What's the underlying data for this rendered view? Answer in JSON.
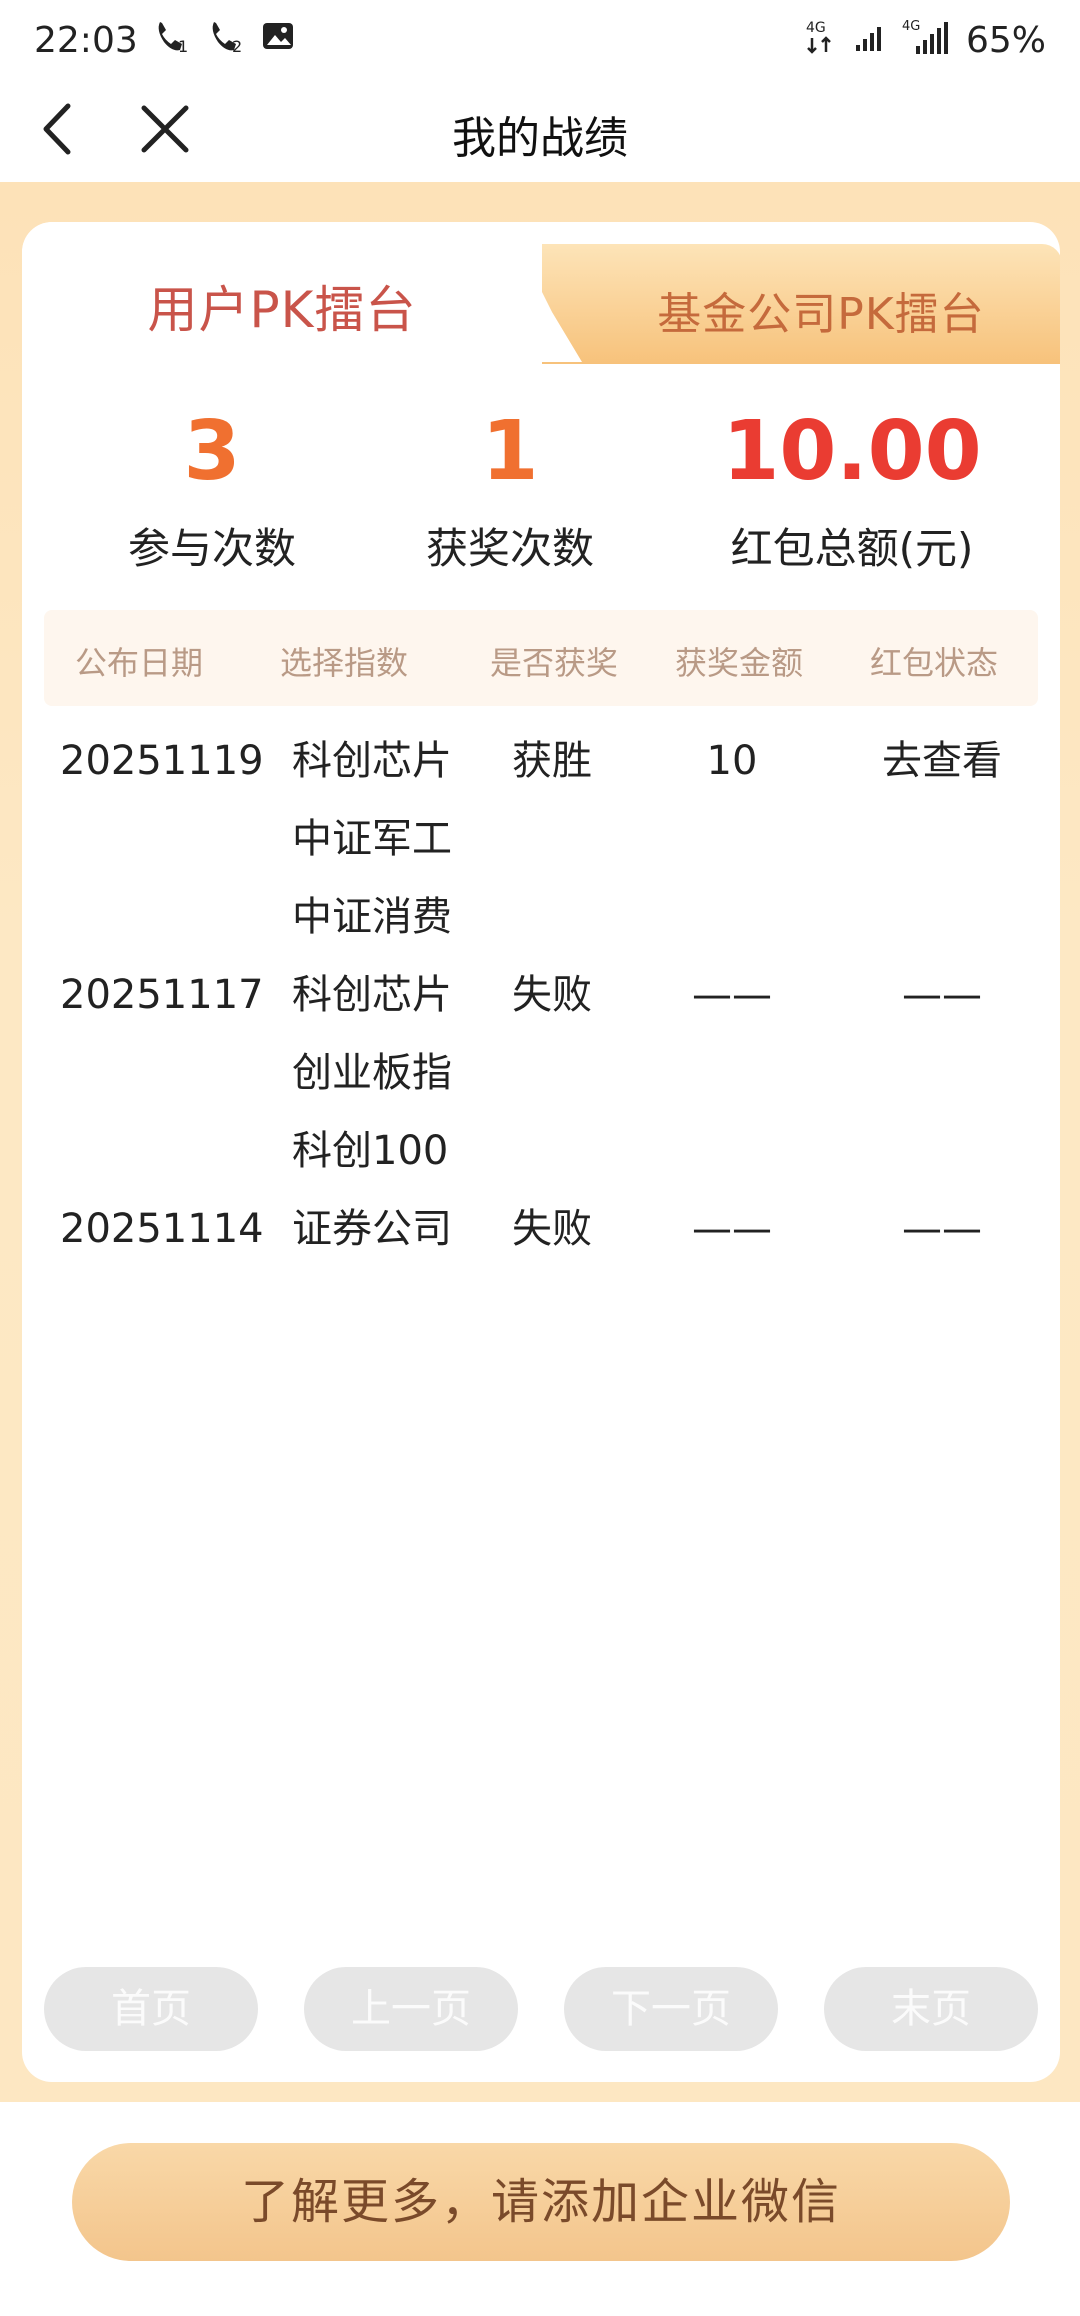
{
  "status_bar": {
    "time": "22:03",
    "left_icons": [
      "call-1-icon",
      "call-2-icon",
      "image-icon"
    ],
    "net1": "4G",
    "net2": "4G",
    "battery": "65%"
  },
  "nav": {
    "title": "我的战绩",
    "back_icon": "chevron-left-icon",
    "close_icon": "close-icon"
  },
  "tabs": {
    "active": "用户PK擂台",
    "inactive": "基金公司PK擂台"
  },
  "stats": [
    {
      "value": "3",
      "label": "参与次数",
      "color": "#f07030"
    },
    {
      "value": "1",
      "label": "获奖次数",
      "color": "#f07030"
    },
    {
      "value": "10.00",
      "label": "红包总额(元)",
      "color": "#ea3c32"
    }
  ],
  "table": {
    "headers": [
      "公布日期",
      "选择指数",
      "是否获奖",
      "获奖金额",
      "红包状态"
    ],
    "rows": [
      {
        "date": "20251119",
        "indices": [
          "科创芯片",
          "中证军工",
          "中证消费"
        ],
        "won": "获胜",
        "amount": "10",
        "status": "去查看"
      },
      {
        "date": "20251117",
        "indices": [
          "科创芯片",
          "创业板指",
          "科创100"
        ],
        "won": "失败",
        "amount": "——",
        "status": "——"
      },
      {
        "date": "20251114",
        "indices": [
          "证券公司"
        ],
        "won": "失败",
        "amount": "——",
        "status": "——"
      }
    ]
  },
  "pager": {
    "first": "首页",
    "prev": "上一页",
    "next": "下一页",
    "last": "末页"
  },
  "cta": "了解更多，请添加企业微信",
  "colors": {
    "accent_orange": "#f07030",
    "accent_red": "#ea3c32",
    "tab_active_text": "#c9544a",
    "background_peach": "#fde4b8"
  }
}
